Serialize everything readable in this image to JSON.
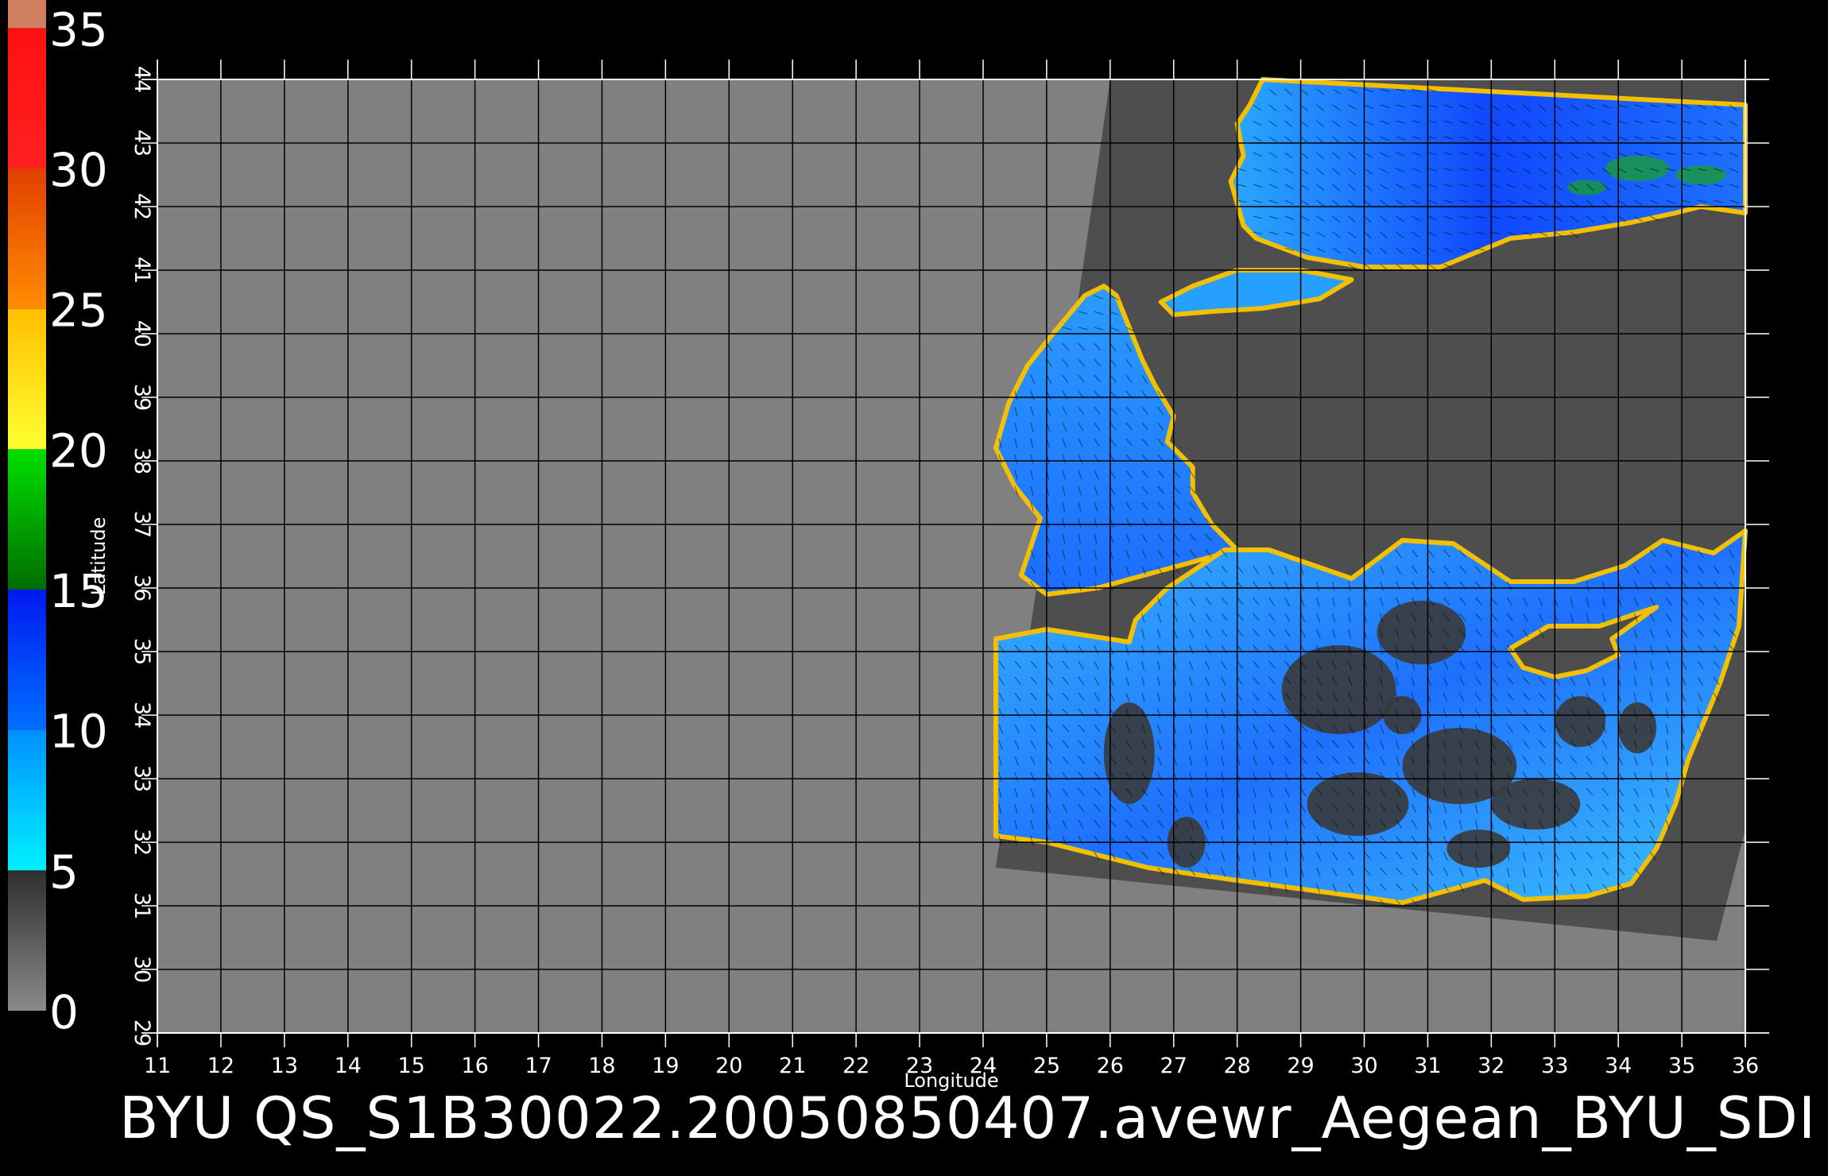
{
  "caption": "BYU  QS_S1B30022.20050850407.avewr_Aegean_BYU_SDI",
  "colorbar": {
    "labels": [
      "0",
      "5",
      "10",
      "15",
      "20",
      "25",
      "30",
      "35"
    ],
    "segments": [
      {
        "from": 0,
        "to": 5,
        "colors": [
          "#8a8a8a",
          "#2e2e2e"
        ]
      },
      {
        "from": 5,
        "to": 10,
        "colors": [
          "#00f0ff",
          "#0090ff"
        ]
      },
      {
        "from": 10,
        "to": 15,
        "colors": [
          "#0070ff",
          "#0018f0"
        ]
      },
      {
        "from": 15,
        "to": 20,
        "colors": [
          "#006c00",
          "#00e000"
        ]
      },
      {
        "from": 20,
        "to": 25,
        "colors": [
          "#ffff30",
          "#ffbe00"
        ]
      },
      {
        "from": 25,
        "to": 30,
        "colors": [
          "#ff8c00",
          "#e04000"
        ]
      },
      {
        "from": 30,
        "to": 35,
        "colors": [
          "#ff2020",
          "#ff1010"
        ]
      },
      {
        "from": 35,
        "to": 36,
        "colors": [
          "#d08060",
          "#d08060"
        ]
      }
    ]
  },
  "map": {
    "xlabel": "Longitude",
    "ylabel": "Latitude",
    "lon_range": [
      11,
      36
    ],
    "lat_range": [
      29,
      44
    ],
    "lon_ticks": [
      "11",
      "12",
      "13",
      "14",
      "15",
      "16",
      "17",
      "18",
      "19",
      "20",
      "21",
      "22",
      "23",
      "24",
      "25",
      "26",
      "27",
      "28",
      "29",
      "30",
      "31",
      "32",
      "33",
      "34",
      "35",
      "36"
    ],
    "lat_ticks": [
      "29",
      "30",
      "31",
      "32",
      "33",
      "34",
      "35",
      "36",
      "37",
      "38",
      "39",
      "40",
      "41",
      "42",
      "43",
      "44"
    ],
    "colors": {
      "no_data": "#808080",
      "land": "#4e4e4e",
      "grid": "#000000",
      "sea_base": "#1e78ff",
      "sea_light": "#3cc0ff",
      "calm": "#3a3a3a"
    }
  }
}
